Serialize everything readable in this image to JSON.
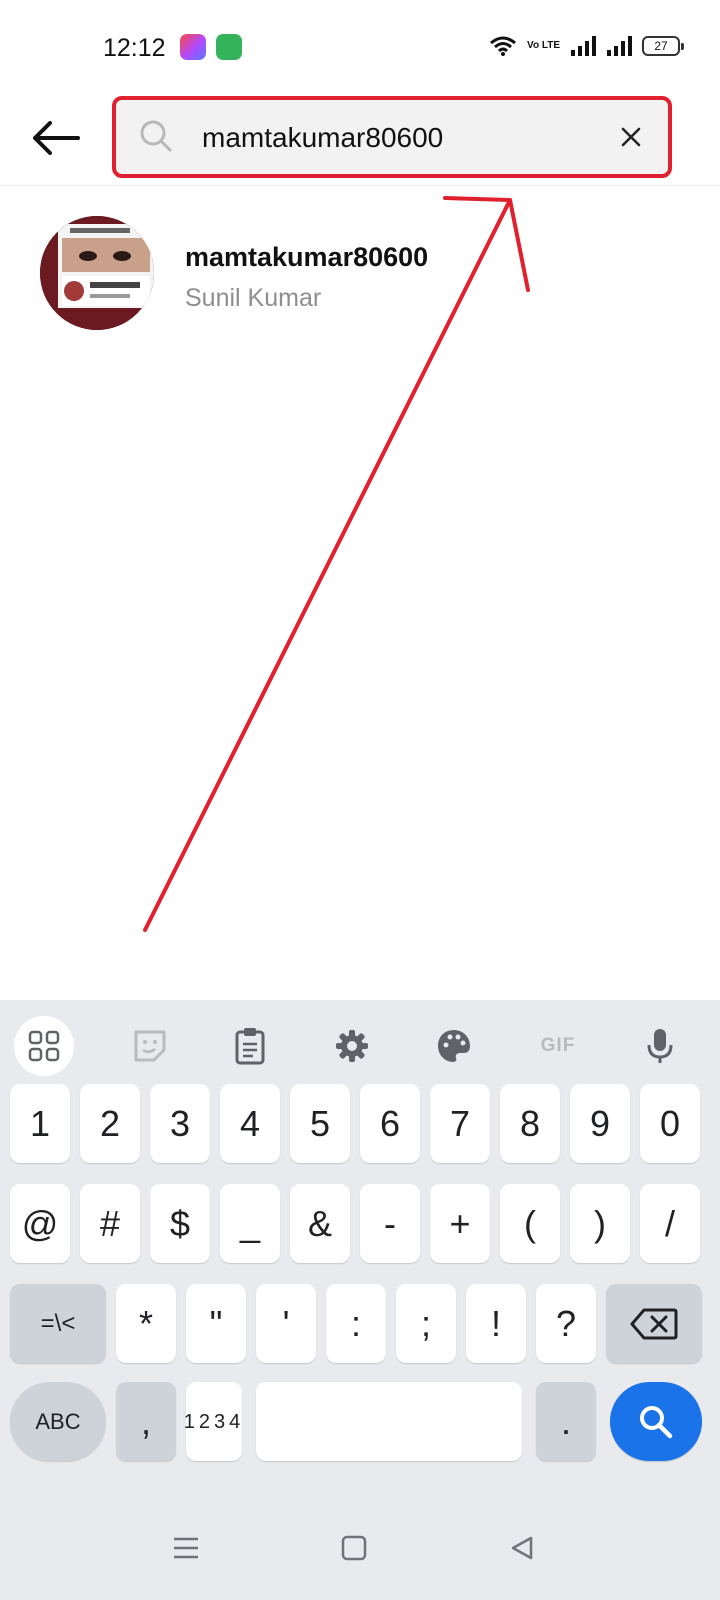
{
  "status_bar": {
    "time": "12:12",
    "network_label": "Vo LTE",
    "battery": "27"
  },
  "search": {
    "query": "mamtakumar80600",
    "highlight_color": "#e0202d"
  },
  "results": [
    {
      "username": "mamtakumar80600",
      "full_name": "Sunil Kumar"
    }
  ],
  "keyboard": {
    "toolbar": [
      "apps-icon",
      "sticker-icon",
      "clipboard-icon",
      "gear-icon",
      "palette-icon",
      "GIF",
      "microphone-icon"
    ],
    "row1": [
      "1",
      "2",
      "3",
      "4",
      "5",
      "6",
      "7",
      "8",
      "9",
      "0"
    ],
    "row2": [
      "@",
      "#",
      "$",
      "_",
      "&",
      "-",
      "+",
      "(",
      ")",
      "/"
    ],
    "row3": [
      "=\\<",
      "*",
      "\"",
      "'",
      ":",
      ";",
      "!",
      "?"
    ],
    "row4": {
      "abc": "ABC",
      "comma": ",",
      "nums_top": "12",
      "nums_bottom": "34",
      "period": "."
    },
    "search_key_color": "#1a73e8"
  },
  "navbar": [
    "menu-icon",
    "home-icon",
    "back-icon"
  ]
}
